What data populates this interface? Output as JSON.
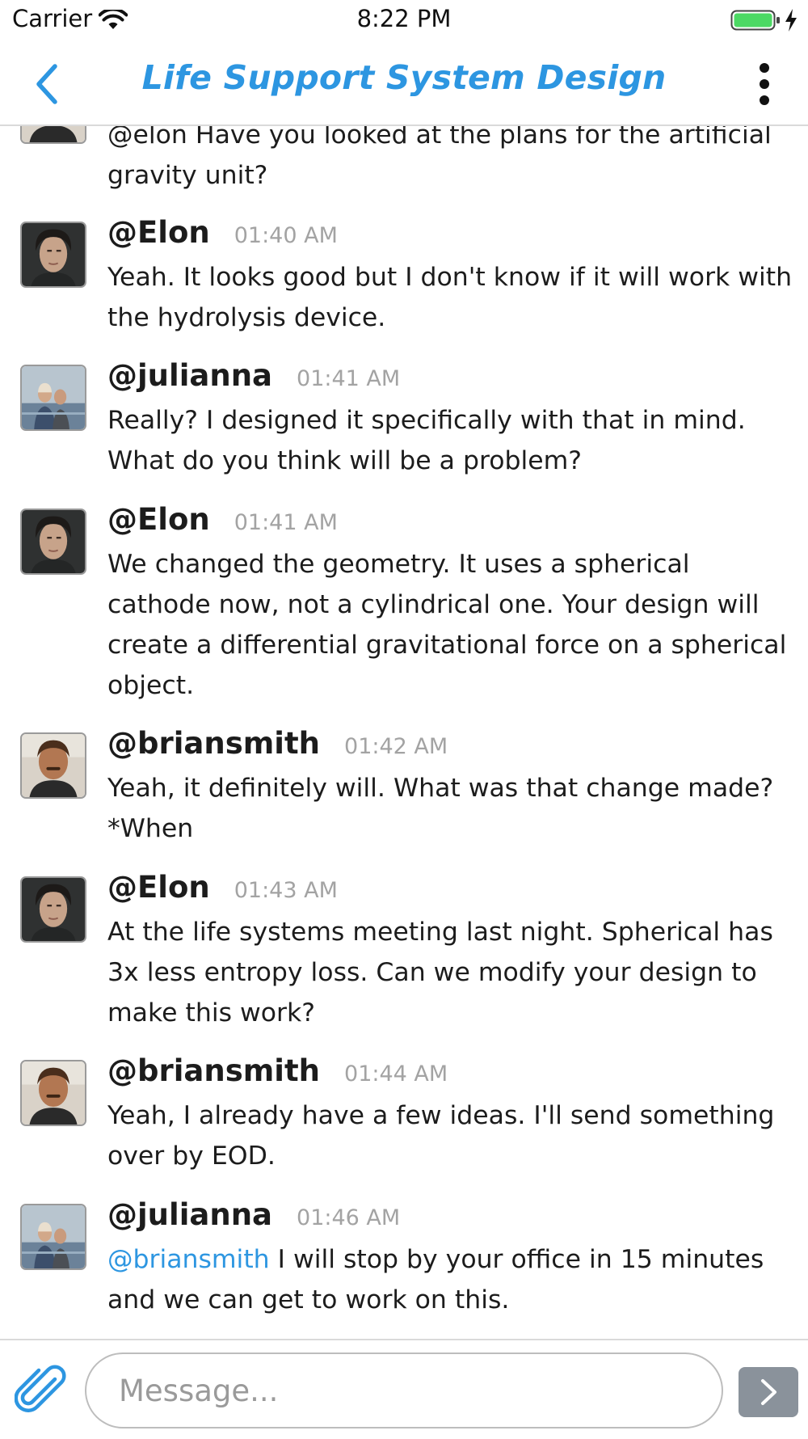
{
  "status_bar": {
    "carrier": "Carrier",
    "time": "8:22 PM"
  },
  "header": {
    "title": "Life Support System Design",
    "accent_color": "#2d96e1",
    "back_icon": "chevron-left-icon",
    "menu_icon": "more-vertical-icon"
  },
  "messages": [
    {
      "partial": true,
      "avatar": "avatar-briansmith",
      "text": "@elon Have you looked at the plans for the artificial gravity unit?"
    },
    {
      "user": "@Elon",
      "time": "01:40 AM",
      "avatar": "avatar-elon",
      "text": "Yeah. It looks good but I don't know if it will work with the hydrolysis device."
    },
    {
      "user": "@julianna",
      "time": "01:41 AM",
      "avatar": "avatar-julianna",
      "text": "Really? I designed it specifically with that in mind. What do you think will be a problem?"
    },
    {
      "user": "@Elon",
      "time": "01:41 AM",
      "avatar": "avatar-elon",
      "text": "We changed the geometry.  It uses a spherical cathode now, not a cylindrical one.  Your design will create a differential gravitational force on a spherical object."
    },
    {
      "user": "@briansmith",
      "time": "01:42 AM",
      "avatar": "avatar-briansmith",
      "text": "Yeah, it definitely will.  What was that change made? *When"
    },
    {
      "user": "@Elon",
      "time": "01:43 AM",
      "avatar": "avatar-elon",
      "text": "At the life systems meeting last night.  Spherical has 3x less entropy loss.  Can we modify your design to make this work?"
    },
    {
      "user": "@briansmith",
      "time": "01:44 AM",
      "avatar": "avatar-briansmith",
      "text": "Yeah, I already have a few ideas.  I'll send something over by EOD."
    },
    {
      "user": "@julianna",
      "time": "01:46 AM",
      "avatar": "avatar-julianna",
      "mention": "@briansmith",
      "text": " I will stop by your office in 15 minutes and we can get to work on this."
    }
  ],
  "composer": {
    "placeholder": "Message...",
    "attach_icon": "paperclip-icon",
    "send_icon": "send-chevron-icon",
    "send_color": "#8a929b"
  }
}
